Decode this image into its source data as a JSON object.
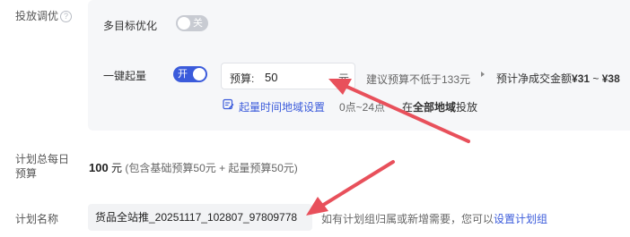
{
  "delivery": {
    "section_label": "投放调优",
    "help_icon": "?",
    "multi_target": {
      "label": "多目标优化",
      "toggle_text": "关",
      "state": "off"
    },
    "quick_start": {
      "label": "一键起量",
      "toggle_text": "开",
      "state": "on",
      "budget_label": "预算:",
      "budget_value": "50",
      "budget_unit": "元",
      "suggestion": "建议预算不低于133元",
      "estimate_prefix": "预计净成交金额",
      "estimate_low": "¥31",
      "estimate_sep": "~",
      "estimate_high": "¥38",
      "schedule_link": "起量时间地域设置",
      "schedule_time": "0点~24点",
      "schedule_in": "在",
      "schedule_region": "全部地域",
      "schedule_suffix": "投放"
    }
  },
  "daily_budget": {
    "label_line1": "计划总每日",
    "label_line2": "预算",
    "amount": "100",
    "unit": "元",
    "detail": "(包含基础预算50元 + 起量预算50元)"
  },
  "plan_name": {
    "label": "计划名称",
    "value": "货品全站推_20251117_102807_97809778",
    "hint": "如有计划组归属或新增需要，您可以",
    "hint_link": "设置计划组"
  },
  "colors": {
    "accent": "#3b5bdb",
    "arrow": "#e8505b"
  }
}
